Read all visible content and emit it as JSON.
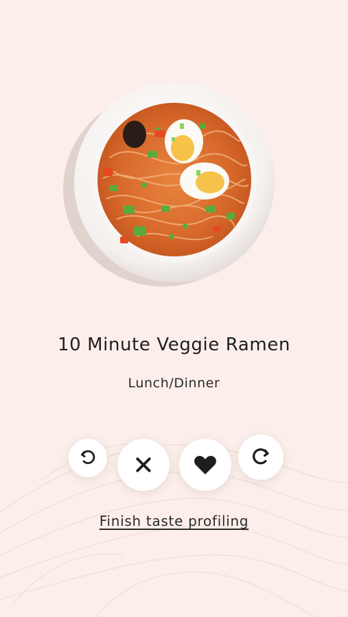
{
  "recipe": {
    "title": "10 Minute Veggie Ramen",
    "category": "Lunch/Dinner"
  },
  "actions": {
    "undo_icon": "rotate-left-icon",
    "nope_icon": "close-icon",
    "like_icon": "heart-icon",
    "redo_icon": "rotate-right-icon"
  },
  "footer": {
    "finish_link": "Finish taste profiling"
  },
  "colors": {
    "background": "#fcefeb",
    "button_bg": "#ffffff",
    "icon": "#1e1e1e",
    "text": "#1e1e1e"
  }
}
